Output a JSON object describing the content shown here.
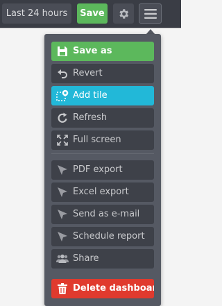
{
  "topbar": {
    "time_range_label": "Last 24 hours",
    "save_label": "Save",
    "settings_icon": "gear-icon",
    "menu_icon": "hamburger-icon"
  },
  "menu": {
    "items": [
      {
        "label": "Save as",
        "icon": "floppy-disk-icon",
        "style": "green"
      },
      {
        "label": "Revert",
        "icon": "undo-arrow-icon"
      },
      {
        "label": "Add tile",
        "icon": "add-tile-icon",
        "style": "cyan"
      },
      {
        "label": "Refresh",
        "icon": "refresh-icon"
      },
      {
        "label": "Full screen",
        "icon": "expand-icon"
      },
      {
        "label": "PDF export",
        "icon": "send-icon"
      },
      {
        "label": "Excel export",
        "icon": "send-icon"
      },
      {
        "label": "Send as e-mail",
        "icon": "send-icon"
      },
      {
        "label": "Schedule report",
        "icon": "send-icon"
      },
      {
        "label": "Share",
        "icon": "users-icon"
      },
      {
        "label": "Delete dashboard",
        "icon": "trash-icon",
        "style": "red"
      }
    ]
  },
  "colors": {
    "topbar": "#3a3d45",
    "menu_bg": "#555963",
    "item_bg": "#3e4149",
    "save_green": "#5cb85c",
    "add_tile_cyan": "#22b8d8",
    "delete_red": "#e03a2e"
  }
}
